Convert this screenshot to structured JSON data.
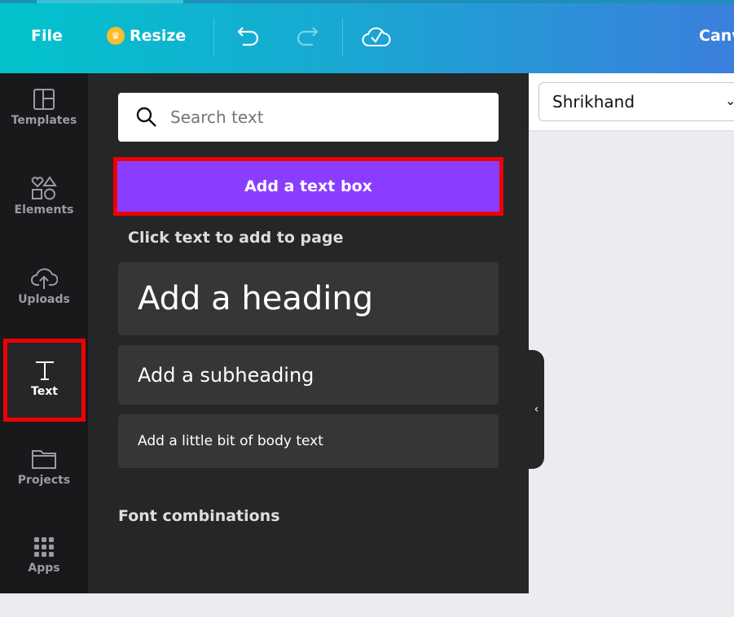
{
  "topbar": {
    "file": "File",
    "resize": "Resize",
    "brand": "Canva"
  },
  "rail": [
    {
      "label": "Templates"
    },
    {
      "label": "Elements"
    },
    {
      "label": "Uploads"
    },
    {
      "label": "Text"
    },
    {
      "label": "Projects"
    },
    {
      "label": "Apps"
    }
  ],
  "panel": {
    "search_placeholder": "Search text",
    "add_textbox": "Add a text box",
    "click_label": "Click text to add to page",
    "heading": "Add a heading",
    "subheading": "Add a subheading",
    "body": "Add a little bit of body text",
    "font_combos": "Font combinations"
  },
  "font_select": {
    "value": "Shrikhand"
  },
  "colors": {
    "accent": "#8b3dff",
    "highlight": "#ee0000"
  }
}
